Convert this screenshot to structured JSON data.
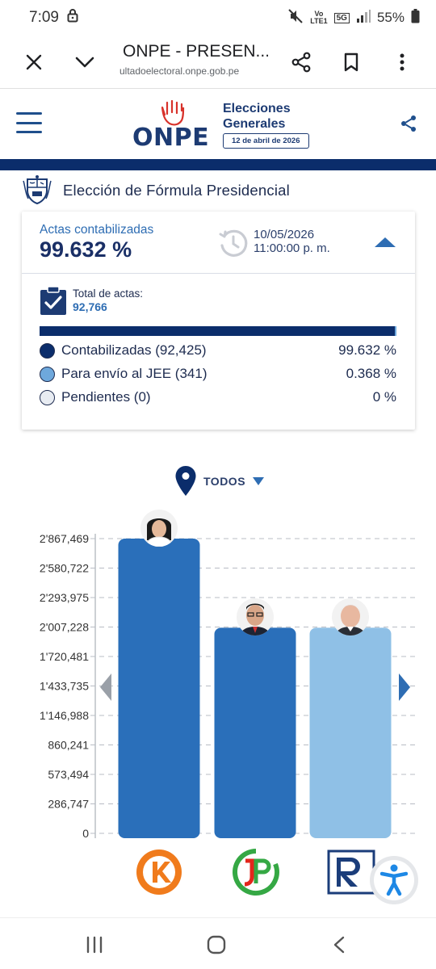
{
  "status_bar": {
    "time": "7:09",
    "volte": "Vo\nLTE1",
    "network": "5G",
    "battery": "55%"
  },
  "browser": {
    "title": "ONPE - PRESEN...",
    "url": "ultadoelectoral.onpe.gob.pe"
  },
  "header": {
    "logo_text": "ONPE",
    "elecciones_line1": "Elecciones",
    "elecciones_line2": "Generales",
    "date_pill": "12 de abril de 2026"
  },
  "page": {
    "title": "Elección de Fórmula Presidencial"
  },
  "summary": {
    "actas_label": "Actas contabilizadas",
    "actas_pct": "99.632 %",
    "date": "10/05/2026",
    "time": "11:00:00 p. m.",
    "total_label": "Total de actas:",
    "total_value": "92,766",
    "progress": {
      "contabilizadas": 0.99632,
      "jee": 0.00368
    },
    "legend": [
      {
        "label": "Contabilizadas (92,425)",
        "value": "99.632 %",
        "color": "#0b2d6b"
      },
      {
        "label": "Para envío al JEE (341)",
        "value": "0.368 %",
        "color": "#6ea8dc"
      },
      {
        "label": "Pendientes (0)",
        "value": "0 %",
        "color": "#e8ecf2"
      }
    ]
  },
  "filter": {
    "label": "TODOS"
  },
  "chart_data": {
    "type": "bar",
    "title": "",
    "xlabel": "",
    "ylabel": "",
    "ylim": [
      0,
      2867469
    ],
    "y_ticks": [
      "0",
      "286,747",
      "573,494",
      "860,241",
      "1'146,988",
      "1'433,735",
      "1'720,481",
      "2'007,228",
      "2'293,975",
      "2'580,722",
      "2'867,469"
    ],
    "y_tick_values": [
      0,
      286747,
      573494,
      860241,
      1146988,
      1433735,
      1720481,
      2007228,
      2293975,
      2580722,
      2867469
    ],
    "categories": [
      "Fuerza Popular",
      "Juntos por el Perú",
      "Renovación Popular"
    ],
    "values": [
      2867469,
      2000000,
      2000000
    ],
    "colors": [
      "#2a6fba",
      "#2a6fba",
      "#8fc0e6"
    ],
    "grid": true
  },
  "colors": {
    "navy": "#0b2d6b",
    "accent": "#2e6db3",
    "bar_dark": "#2a6fba",
    "bar_light": "#8fc0e6"
  },
  "icons": {
    "close": "close-icon",
    "collapse": "chevron-down-icon",
    "share": "share-icon",
    "bookmark": "bookmark-icon",
    "more": "more-vert-icon",
    "menu": "hamburger-icon",
    "accessibility": "accessibility-icon"
  }
}
